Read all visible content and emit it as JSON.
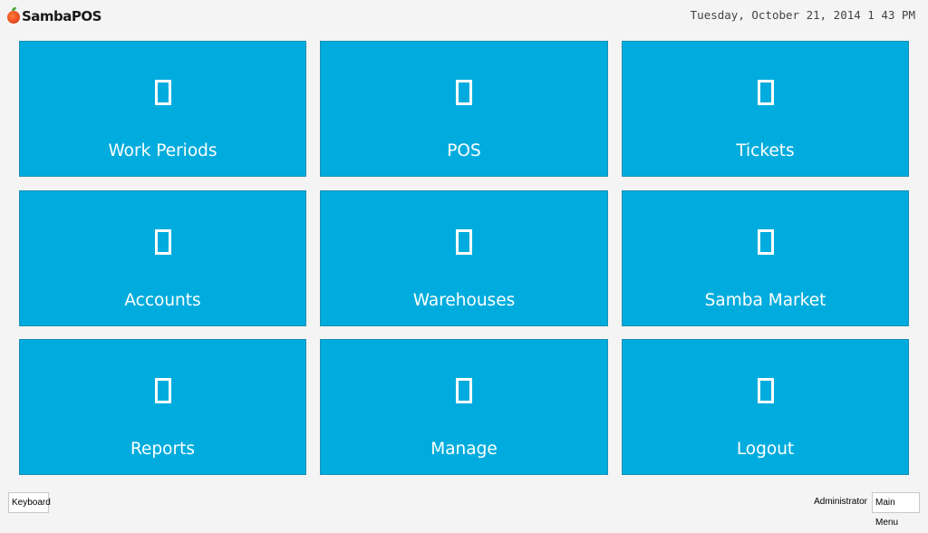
{
  "header": {
    "logo_text": "SambaPOS",
    "datetime": "Tuesday, October 21, 2014 1 43 PM"
  },
  "colors": {
    "tile_background": "#00acdd",
    "tile_text": "#ffffff",
    "page_background": "#f4f4f4"
  },
  "tiles": [
    {
      "label": "Work Periods",
      "icon": "placeholder-box-icon"
    },
    {
      "label": "POS",
      "icon": "placeholder-box-icon"
    },
    {
      "label": "Tickets",
      "icon": "placeholder-box-icon"
    },
    {
      "label": "Accounts",
      "icon": "placeholder-box-icon"
    },
    {
      "label": "Warehouses",
      "icon": "placeholder-box-icon"
    },
    {
      "label": "Samba Market",
      "icon": "placeholder-box-icon"
    },
    {
      "label": "Reports",
      "icon": "placeholder-box-icon"
    },
    {
      "label": "Manage",
      "icon": "placeholder-box-icon"
    },
    {
      "label": "Logout",
      "icon": "placeholder-box-icon"
    }
  ],
  "footer": {
    "keyboard_label": "Keyboard",
    "user_name": "Administrator",
    "main_menu_label": "Main Menu"
  }
}
